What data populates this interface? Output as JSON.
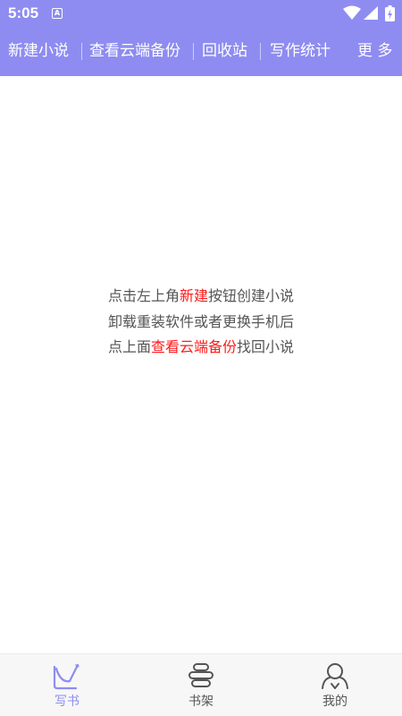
{
  "colors": {
    "accent": "#8e8cf1",
    "highlight": "#ff1a1a",
    "text": "#555555",
    "tab_inactive": "#555555"
  },
  "status_bar": {
    "time": "5:05",
    "notification_icon": "a-icon",
    "icons": [
      "wifi-icon",
      "signal-icon",
      "battery-icon"
    ]
  },
  "toolbar": {
    "items": [
      {
        "label": "新建小说"
      },
      {
        "label": "查看云端备份"
      },
      {
        "label": "回收站"
      },
      {
        "label": "写作统计"
      }
    ],
    "more_label": "更 多"
  },
  "empty_hint": {
    "line1": {
      "before": "点击左上角",
      "highlight": "新建",
      "after": "按钮创建小说"
    },
    "line2": "卸载重装软件或者更换手机后",
    "line3": {
      "before": "点上面",
      "highlight": "查看云端备份",
      "after": "找回小说"
    }
  },
  "tabbar": {
    "tabs": [
      {
        "label": "写书",
        "icon": "write-book-icon",
        "active": true
      },
      {
        "label": "书架",
        "icon": "bookshelf-icon",
        "active": false
      },
      {
        "label": "我的",
        "icon": "user-icon",
        "active": false
      }
    ]
  }
}
